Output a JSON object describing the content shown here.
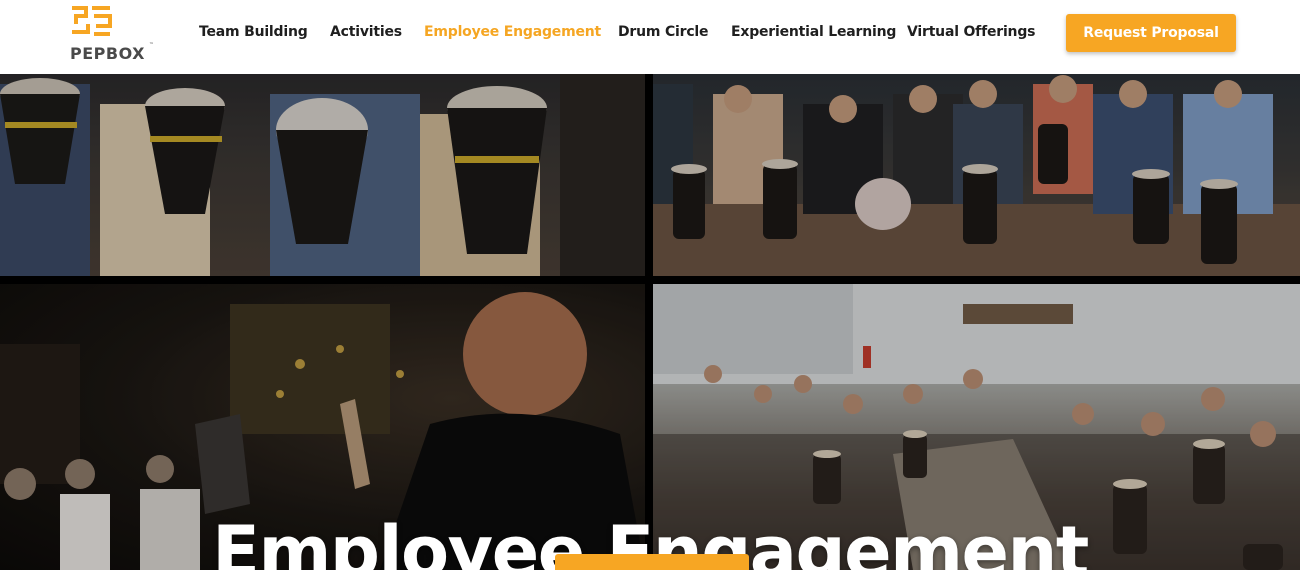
{
  "brand": {
    "logo_text": "PEPBOX",
    "trademark": "™",
    "accent_color": "#f7a623"
  },
  "nav": {
    "items": [
      {
        "label": "Team Building",
        "active": false
      },
      {
        "label": "Activities",
        "active": false
      },
      {
        "label": "Employee Engagement",
        "active": true
      },
      {
        "label": "Drum Circle",
        "active": false
      },
      {
        "label": "Experiential Learning",
        "active": false
      },
      {
        "label": "Virtual Offerings",
        "active": false
      }
    ],
    "cta_label": "Request Proposal"
  },
  "hero": {
    "title": "Employee Engagement",
    "tiles": [
      "drum-circle-closeup-photo",
      "group-drumming-photo",
      "facilitator-drum-session-photo",
      "office-drum-circle-photo"
    ]
  }
}
